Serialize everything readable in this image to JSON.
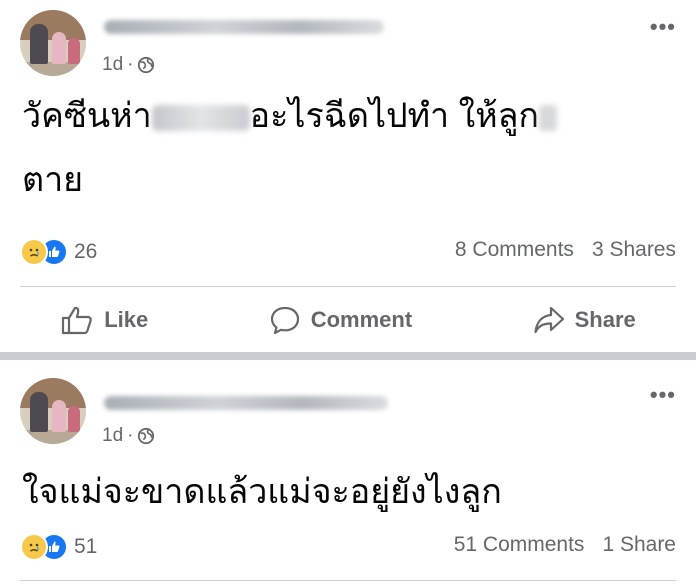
{
  "posts": [
    {
      "time": "1d",
      "dot": "·",
      "text_line1_a": "วัคซีนห่า",
      "text_line1_b": "อะไรฉีดไปทำ ให้ลูก",
      "text_line2": "ตาย",
      "reaction_count": "26",
      "comments": "8 Comments",
      "shares": "3 Shares",
      "actions": {
        "like": "Like",
        "comment": "Comment",
        "share": "Share"
      }
    },
    {
      "time": "1d",
      "dot": "·",
      "text": "ใจแม่จะขาดแล้วแม่จะอยู่ยังไงลูก",
      "reaction_count": "51",
      "comments": "51 Comments",
      "shares": "1 Share"
    }
  ],
  "more_label": "•••",
  "colors": {
    "like_blue": "#1877f2",
    "sad_yellow": "#f7c94a",
    "secondary_text": "#65676b",
    "divider": "#c9ccd1"
  },
  "icons": [
    "globe-icon",
    "sad-reaction-icon",
    "like-reaction-icon",
    "like-icon",
    "comment-icon",
    "share-icon",
    "more-icon"
  ]
}
